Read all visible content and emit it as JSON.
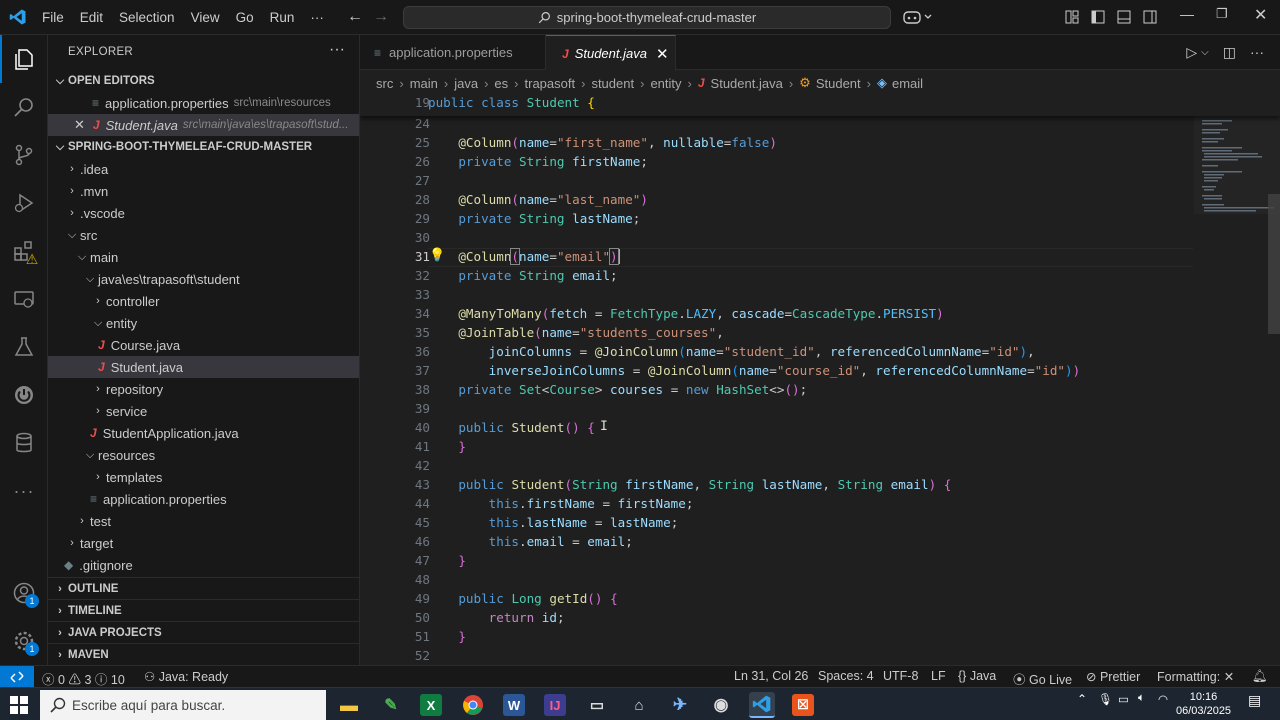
{
  "titlebar": {
    "menu": [
      "File",
      "Edit",
      "Selection",
      "View",
      "Go",
      "Run",
      "···"
    ],
    "search_text": "spring-boot-thymeleaf-crud-master"
  },
  "sidebar": {
    "header": "EXPLORER",
    "open_editors_label": "OPEN EDITORS",
    "open_editors": [
      {
        "name": "application.properties",
        "path": "src\\main\\resources"
      },
      {
        "name": "Student.java",
        "path": "src\\main\\java\\es\\trapasoft\\stud..."
      }
    ],
    "project_label": "SPRING-BOOT-THYMELEAF-CRUD-MASTER",
    "tree": [
      ".idea",
      ".mvn",
      ".vscode",
      "src",
      "main",
      "java\\es\\trapasoft\\student",
      "controller",
      "entity",
      "Course.java",
      "Student.java",
      "repository",
      "service",
      "StudentApplication.java",
      "resources",
      "templates",
      "application.properties",
      "test",
      "target",
      ".gitignore"
    ],
    "sections": [
      "OUTLINE",
      "TIMELINE",
      "JAVA PROJECTS",
      "MAVEN"
    ]
  },
  "editor": {
    "tabs": [
      {
        "label": "application.properties",
        "active": false
      },
      {
        "label": "Student.java",
        "active": true
      }
    ],
    "breadcrumb": [
      "src",
      "main",
      "java",
      "es",
      "trapasoft",
      "student",
      "entity",
      "Student.java",
      "Student",
      "email"
    ],
    "sticky_line": {
      "number": "19",
      "text": "public class Student {"
    },
    "line_numbers": [
      "24",
      "25",
      "26",
      "27",
      "28",
      "29",
      "30",
      "31",
      "32",
      "33",
      "34",
      "35",
      "36",
      "37",
      "38",
      "39",
      "40",
      "41",
      "42",
      "43",
      "44",
      "45",
      "46",
      "47",
      "48",
      "49",
      "50",
      "51",
      "52"
    ],
    "current_line": "31"
  },
  "statusbar": {
    "problems": "0",
    "warnings": "3",
    "info": "10",
    "java_status": "Java: Ready",
    "position": "Ln 31, Col 26",
    "spaces": "Spaces: 4",
    "encoding": "UTF-8",
    "eol": "LF",
    "language": "Java",
    "golive": "Go Live",
    "prettier": "Prettier",
    "formatting": "Formatting:"
  },
  "taskbar": {
    "search_placeholder": "Escribe aquí para buscar.",
    "time": "10:16",
    "date": "06/03/2025"
  },
  "colors": {
    "accent": "#0078d4",
    "keyword": "#569cd6",
    "type": "#4ec9b0",
    "string": "#ce9178",
    "variable": "#9cdcfe"
  }
}
